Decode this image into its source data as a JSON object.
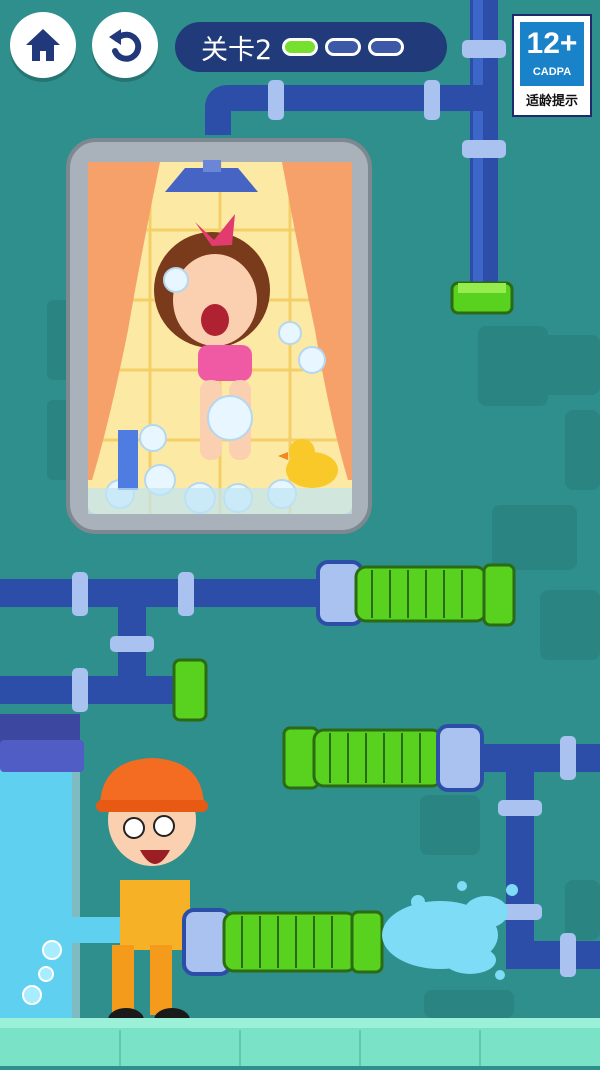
{
  "hud": {
    "home_icon": "home-icon",
    "restart_icon": "restart-icon",
    "level_label": "关卡2",
    "level_stages": [
      {
        "state": "done"
      },
      {
        "state": "todo"
      },
      {
        "state": "todo"
      }
    ]
  },
  "age_rating": {
    "rating": "12+",
    "org": "CADPA",
    "hint": "适龄提示"
  },
  "colors": {
    "background": "#2f8f8c",
    "pipe": "#2d4ea8",
    "pipe_joint": "#a9c2f0",
    "hose": "#59d11f",
    "water": "#5fd0f0",
    "floor": "#79e2c7"
  }
}
